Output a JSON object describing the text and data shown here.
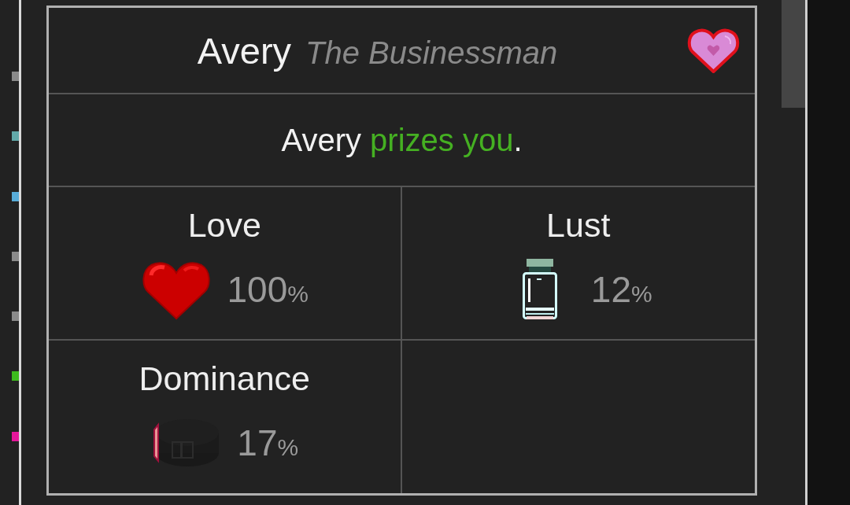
{
  "side_markers": [
    {
      "color": "#8a8a8a"
    },
    {
      "color": "#62a9a9"
    },
    {
      "color": "#58acd8"
    },
    {
      "color": "#8a8a8a"
    },
    {
      "color": "#8a8a8a"
    },
    {
      "color": "#3dbb1e"
    },
    {
      "color": "#e4169a"
    }
  ],
  "card": {
    "title": "Avery",
    "subtitle": "The Businessman",
    "status": {
      "subject": "Avery",
      "highlight": "prizes you",
      "end": "."
    },
    "stats": [
      {
        "kind": "love",
        "label": "Love",
        "value": "100",
        "unit": "%"
      },
      {
        "kind": "lust",
        "label": "Lust",
        "value": "12",
        "unit": "%"
      },
      {
        "kind": "dominance",
        "label": "Dominance",
        "value": "17",
        "unit": "%"
      }
    ]
  }
}
